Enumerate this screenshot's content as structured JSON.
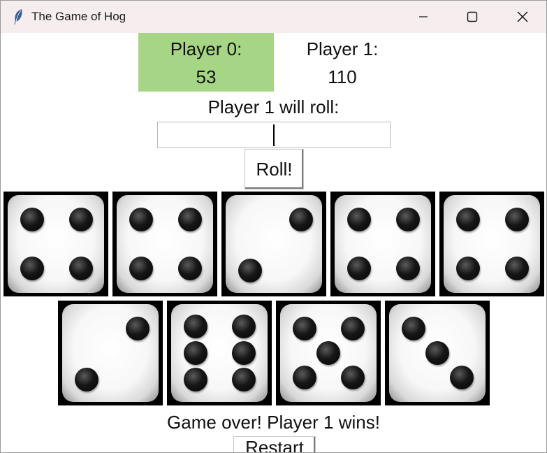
{
  "window": {
    "title": "The Game of Hog",
    "icon": "feather-icon",
    "controls": [
      "minimize-icon",
      "maximize-icon",
      "close-icon"
    ]
  },
  "scoreboard": {
    "player0": {
      "label": "Player 0:",
      "score": "53",
      "highlight_color": "#a6d586"
    },
    "player1": {
      "label": "Player 1:",
      "score": "110"
    }
  },
  "roll": {
    "prompt": "Player 1 will roll:",
    "input_value": "",
    "button_label": "Roll!"
  },
  "dice": {
    "row1": [
      4,
      4,
      2,
      4,
      4
    ],
    "row2": [
      2,
      6,
      5,
      3
    ]
  },
  "status": "Game over! Player 1 wins!",
  "restart_label": "Restart"
}
